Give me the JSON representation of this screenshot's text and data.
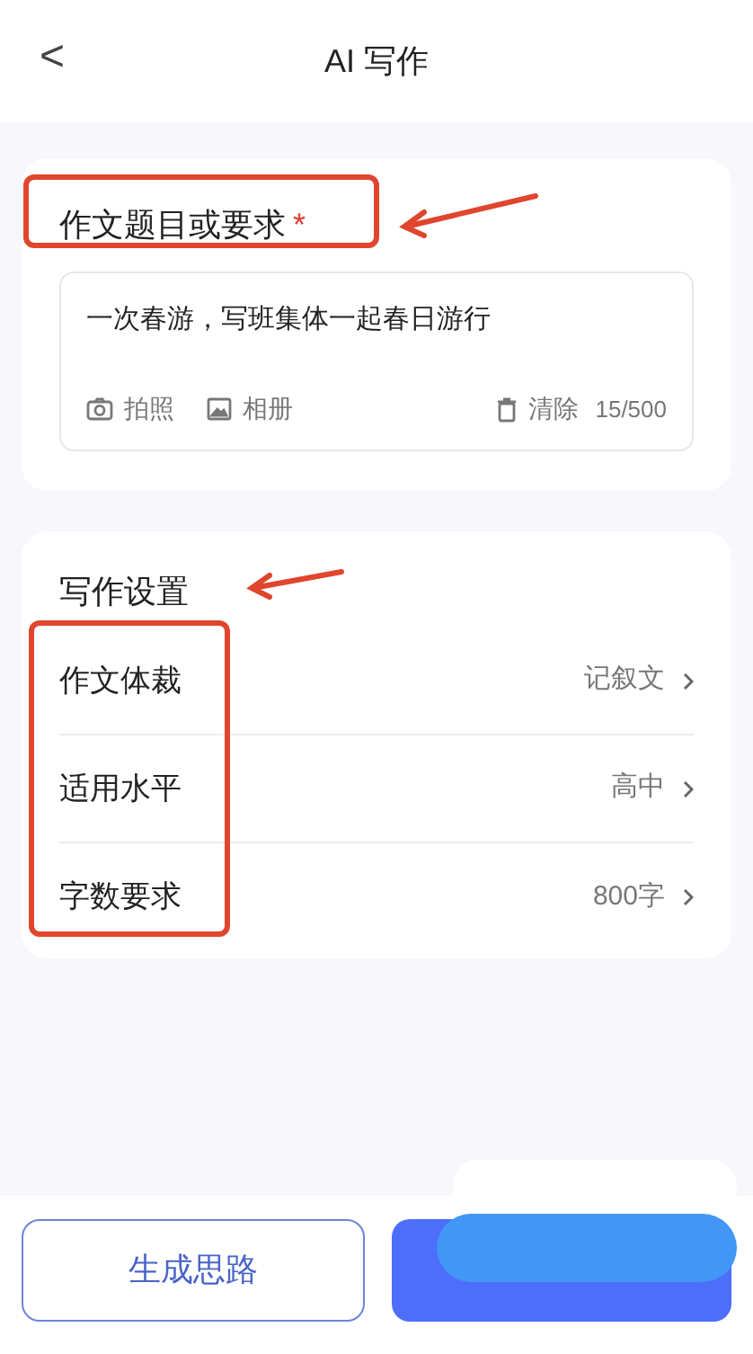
{
  "header": {
    "back": "<",
    "title": "AI 写作"
  },
  "topic": {
    "label": "作文题目或要求",
    "required_mark": "*",
    "value": "一次春游，写班集体一起春日游行",
    "tools": [
      {
        "kind": "camera",
        "label": "拍照"
      },
      {
        "kind": "image",
        "label": "相册"
      }
    ],
    "clear": "清除",
    "count": "15/500"
  },
  "settings": {
    "title": "写作设置",
    "rows": [
      {
        "label": "作文体裁",
        "value": "记叙文"
      },
      {
        "label": "适用水平",
        "value": "高中"
      },
      {
        "label": "字数要求",
        "value": "800字"
      }
    ]
  },
  "buttons": [
    {
      "kind": "outline",
      "label": "生成思路"
    },
    {
      "kind": "primary"
    }
  ]
}
